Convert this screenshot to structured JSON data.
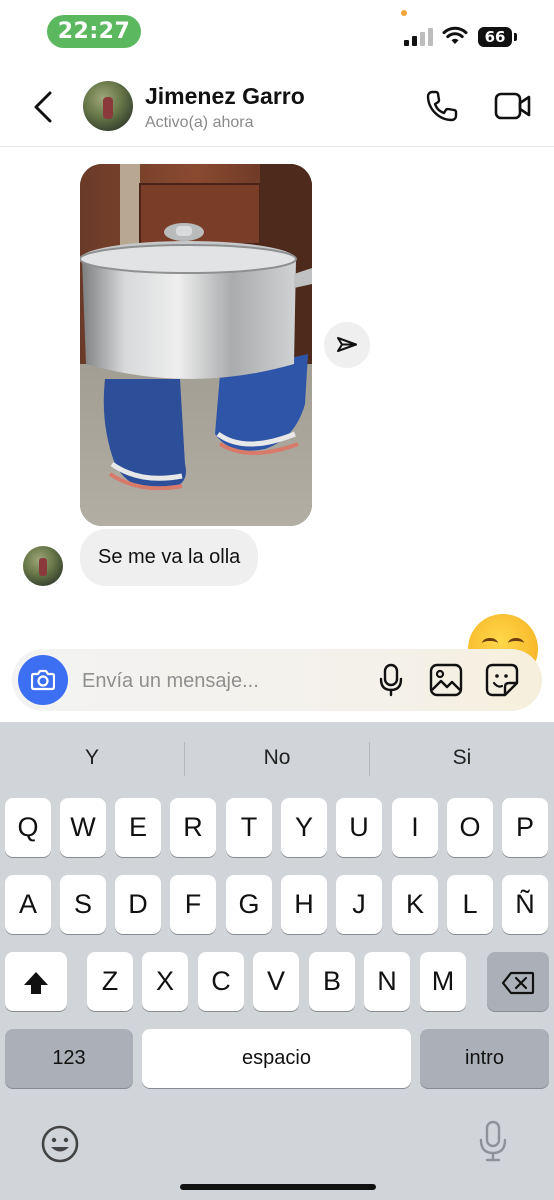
{
  "status_bar": {
    "time": "22:27",
    "battery": "66"
  },
  "header": {
    "name": "Jimenez Garro",
    "status": "Activo(a) ahora"
  },
  "messages": [
    {
      "type": "photo",
      "from": "contact"
    },
    {
      "type": "text",
      "from": "contact",
      "text": "Se me va la olla"
    }
  ],
  "composer": {
    "placeholder": "Envía un mensaje...",
    "value": ""
  },
  "keyboard": {
    "suggestions": [
      "Y",
      "No",
      "Si"
    ],
    "row1": [
      "Q",
      "W",
      "E",
      "R",
      "T",
      "Y",
      "U",
      "I",
      "O",
      "P"
    ],
    "row2": [
      "A",
      "S",
      "D",
      "F",
      "G",
      "H",
      "J",
      "K",
      "L",
      "Ñ"
    ],
    "row3": [
      "Z",
      "X",
      "C",
      "V",
      "B",
      "N",
      "M"
    ],
    "numbers_key": "123",
    "space_key": "espacio",
    "return_key": "intro"
  },
  "colors": {
    "accent": "#3c6ff2",
    "time_pill": "#5cb85f",
    "keyboard_bg": "#d1d4d9"
  }
}
